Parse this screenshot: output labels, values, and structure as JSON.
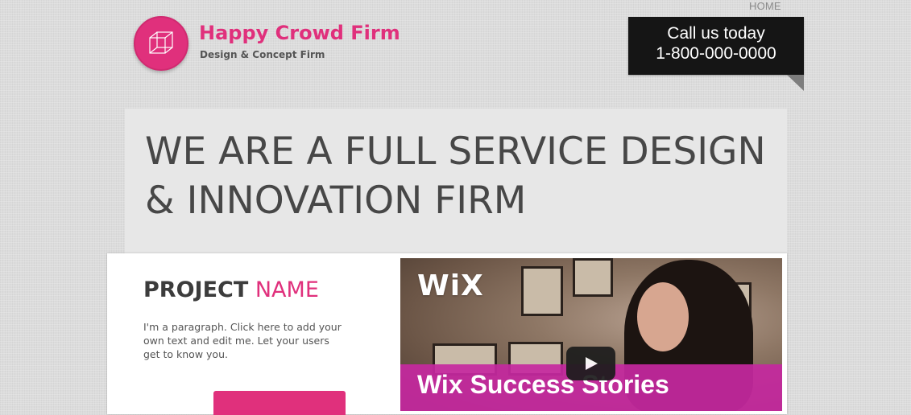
{
  "nav": {
    "home_label": "HOME"
  },
  "brand": {
    "name": "Happy Crowd Firm",
    "tagline": "Design & Concept Firm",
    "logo_icon": "cube-icon"
  },
  "call": {
    "title": "Call us today",
    "phone": "1-800-000-0000"
  },
  "hero": {
    "line1": "WE ARE A FULL SERVICE DESIGN",
    "line2": "& INNOVATION FIRM"
  },
  "project": {
    "heading_word1": "PROJECT",
    "heading_word2": "NAME",
    "paragraph": "I'm a paragraph. Click here to add your own text and edit me. Let your users get to know you."
  },
  "video": {
    "logo_text": "WiX",
    "caption": "Wix Success Stories",
    "play_icon": "play-icon"
  },
  "colors": {
    "accent": "#e0307c",
    "dark_box": "#151515",
    "background": "#dcdcdc",
    "hero_band": "#e7e7e7",
    "video_band": "#c628a0"
  }
}
